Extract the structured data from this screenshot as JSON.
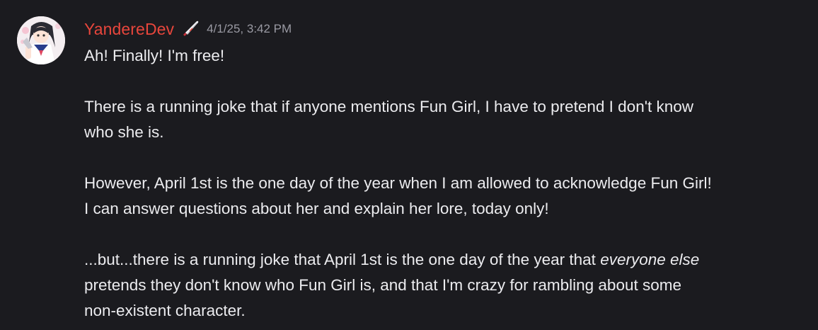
{
  "message": {
    "author": "YandereDev",
    "author_color": "#e8463c",
    "role_icon": "knife-icon",
    "timestamp": "4/1/25, 3:42 PM",
    "paragraphs": {
      "p1": "Ah! Finally! I'm free!",
      "p2_line1": "There is a running joke that if anyone mentions Fun Girl, I have to pretend I don't know",
      "p2_line2": "who she is.",
      "p3_line1": "However, April 1st is the one day of the year when I am allowed to acknowledge Fun Girl!",
      "p3_line2": "I can answer questions about her and explain her lore, today only!",
      "p4_line1_a": "...but...there is a running joke that April 1st is the one day of the year that ",
      "p4_line1_em": "everyone else",
      "p4_line2": "pretends they don't know who Fun Girl is, and that I'm crazy for rambling about some",
      "p4_line3": "non-existent character."
    }
  },
  "colors": {
    "background": "#1b1b1f",
    "text": "#ececef",
    "timestamp": "#9a9aa3"
  }
}
